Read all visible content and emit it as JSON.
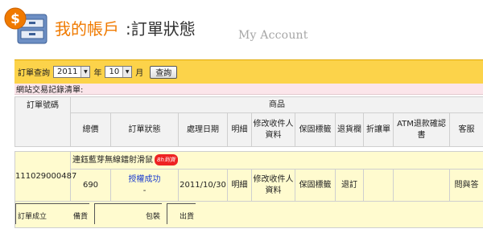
{
  "header": {
    "title_accent": "我的帳戶",
    "title_main": ":訂單狀態",
    "title_en": "My Account"
  },
  "query": {
    "label": "訂單查詢",
    "year": "2011",
    "year_unit": "年",
    "month": "10",
    "month_unit": "月",
    "button": "查詢"
  },
  "list_title": "網站交易記錄清單:",
  "table": {
    "col_order_no": "訂單號碼",
    "col_product": "商品",
    "headers": [
      "總價",
      "訂單狀態",
      "處理日期",
      "明細",
      "修改收件人資料",
      "保固標籤",
      "退貨欄",
      "折讓單",
      "ATM退款確認書",
      "客服"
    ],
    "product_name": "連鈺藍芽無線鐳射滑鼠",
    "product_badge": "8h到貨",
    "order": {
      "order_no": "111029000487",
      "total": "690",
      "status": "授權成功",
      "status_sub": "-",
      "date": "2011/10/30",
      "detail": "明細",
      "edit_recipient": "修改收件人資料",
      "warranty": "保固標籤",
      "return": "退訂",
      "allowance": "",
      "atm": "",
      "service": "問與答"
    },
    "flow": [
      "訂單成立",
      "備貨",
      "包裝",
      "出貨"
    ]
  }
}
